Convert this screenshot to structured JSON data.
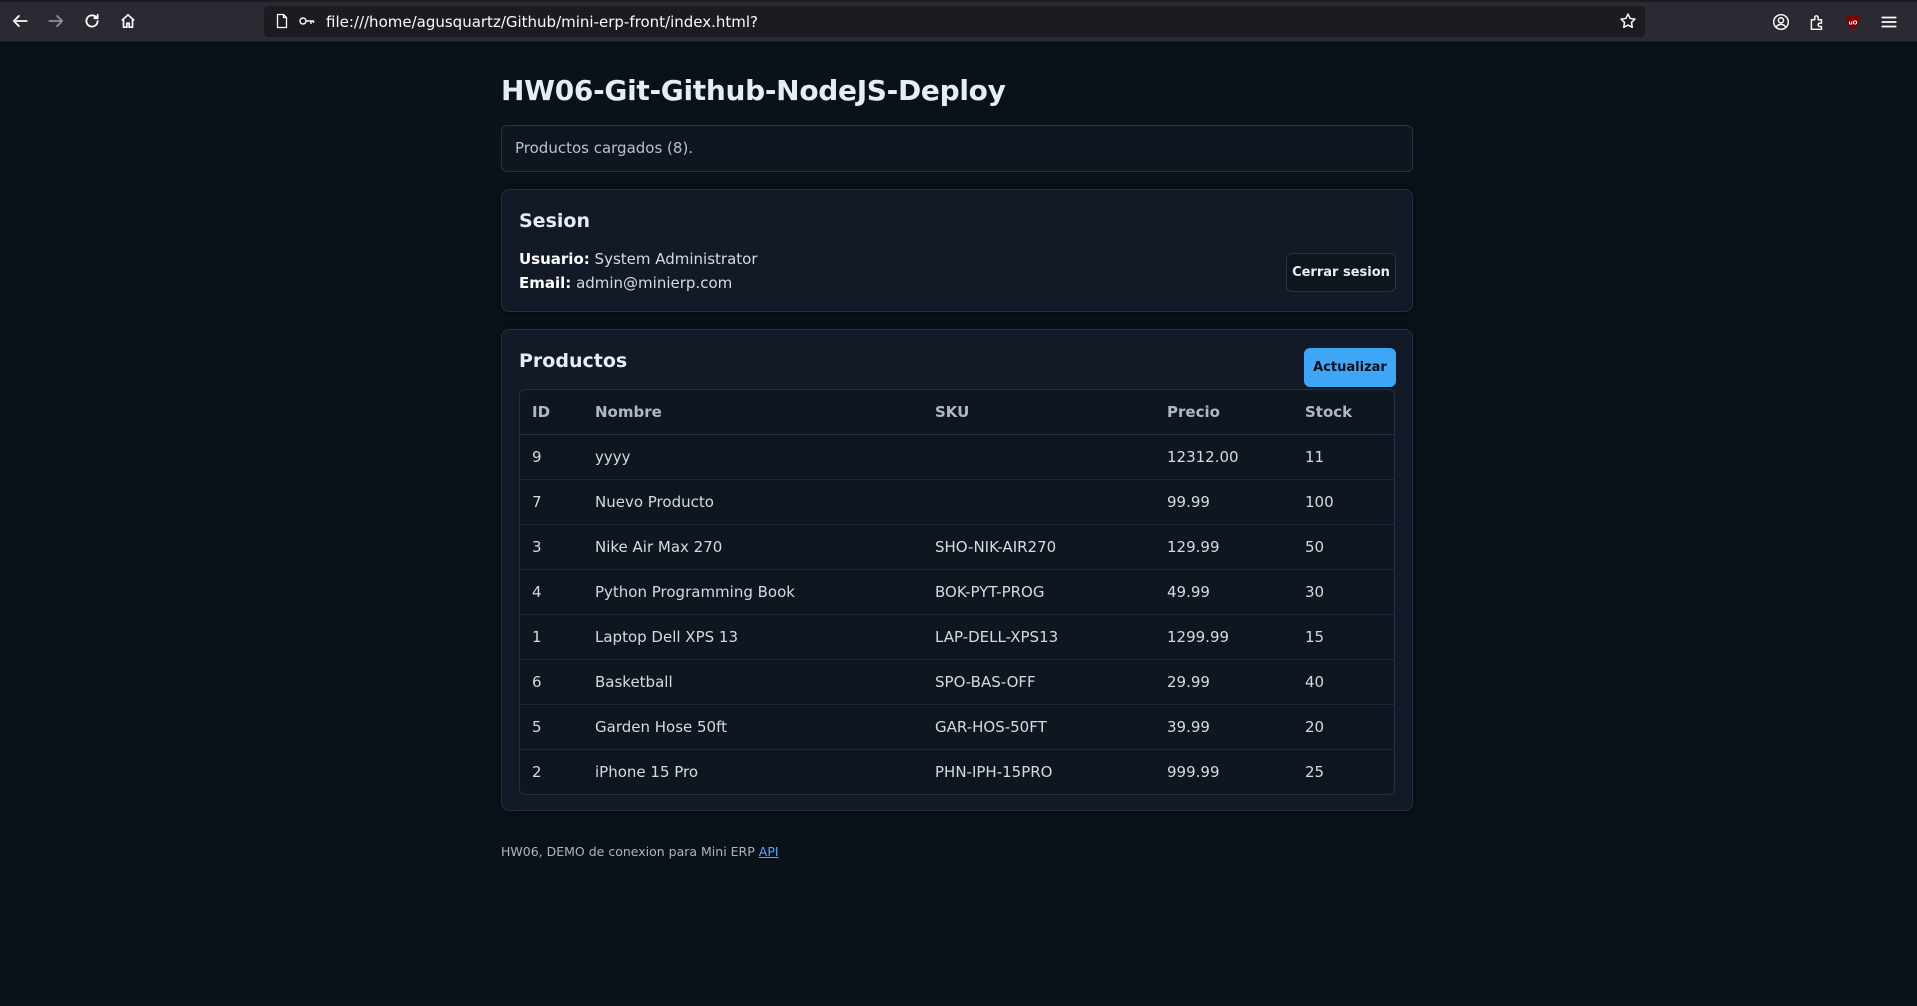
{
  "browser": {
    "url": "file:///home/agusquartz/Github/mini-erp-front/index.html?"
  },
  "page": {
    "title": "HW06-Git-Github-NodeJS-Deploy",
    "status": "Productos cargados (8)."
  },
  "session": {
    "title": "Sesion",
    "user_label": "Usuario:",
    "user_value": "System Administrator",
    "email_label": "Email:",
    "email_value": "admin@minierp.com",
    "logout_label": "Cerrar sesion"
  },
  "products": {
    "title": "Productos",
    "refresh_label": "Actualizar",
    "columns": [
      "ID",
      "Nombre",
      "SKU",
      "Precio",
      "Stock"
    ],
    "rows": [
      {
        "id": "9",
        "name": "yyyy",
        "sku": "",
        "price": "12312.00",
        "stock": "11"
      },
      {
        "id": "7",
        "name": "Nuevo Producto",
        "sku": "",
        "price": "99.99",
        "stock": "100"
      },
      {
        "id": "3",
        "name": "Nike Air Max 270",
        "sku": "SHO-NIK-AIR270",
        "price": "129.99",
        "stock": "50"
      },
      {
        "id": "4",
        "name": "Python Programming Book",
        "sku": "BOK-PYT-PROG",
        "price": "49.99",
        "stock": "30"
      },
      {
        "id": "1",
        "name": "Laptop Dell XPS 13",
        "sku": "LAP-DELL-XPS13",
        "price": "1299.99",
        "stock": "15"
      },
      {
        "id": "6",
        "name": "Basketball",
        "sku": "SPO-BAS-OFF",
        "price": "29.99",
        "stock": "40"
      },
      {
        "id": "5",
        "name": "Garden Hose 50ft",
        "sku": "GAR-HOS-50FT",
        "price": "39.99",
        "stock": "20"
      },
      {
        "id": "2",
        "name": "iPhone 15 Pro",
        "sku": "PHN-IPH-15PRO",
        "price": "999.99",
        "stock": "25"
      }
    ]
  },
  "footer": {
    "text": "HW06, DEMO de conexion para Mini ERP",
    "link_label": "API"
  },
  "colors": {
    "background": "#0b1119",
    "card": "#111a26",
    "accent": "#3ea6f5",
    "link": "#58a6ff"
  }
}
